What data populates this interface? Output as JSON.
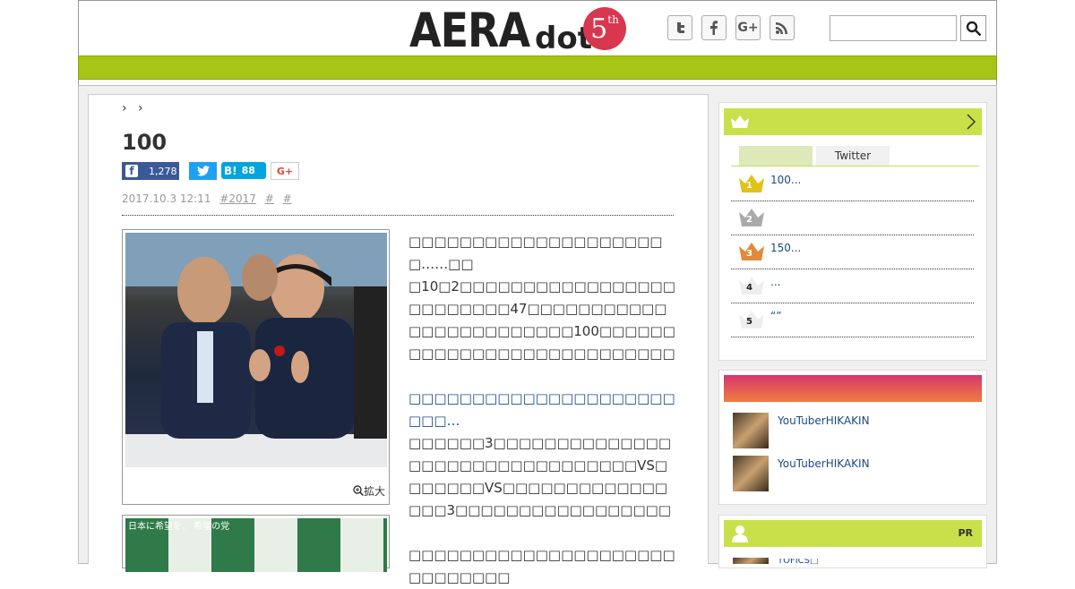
{
  "header": {
    "logo_main": "AERA",
    "logo_sub": "dot",
    "anniversary_number": "5",
    "anniversary_suffix": "th",
    "social": [
      {
        "icon": "twitter-icon",
        "glyph": "t"
      },
      {
        "icon": "facebook-icon",
        "glyph": "f"
      },
      {
        "icon": "google-plus-icon",
        "glyph": "G+"
      },
      {
        "icon": "rss-icon",
        "glyph": ")"
      }
    ],
    "search": {
      "value": "",
      "placeholder": ""
    }
  },
  "colors": {
    "brand_green": "#a6c514",
    "link_blue": "#1a4a8a",
    "rank_gold": "#e0c21a",
    "rank_silver": "#aaaaaa",
    "rank_bronze": "#e08a3a"
  },
  "article": {
    "breadcrumb": "› ›",
    "title": "100",
    "share": {
      "facebook_count": "1,278",
      "hatena_label": "B!",
      "hatena_count": "88",
      "google_label": "G+"
    },
    "meta": {
      "date": "2017.10.3 12:11",
      "tags": [
        "#2017",
        "#",
        "#"
      ]
    },
    "photo_zoom_label": "拡大",
    "photo2_caption": "日本に希望を。 希望の党",
    "paragraphs": [
      "□□□□□□□□□□□□□□□□□□□□□……□□",
      "□10□2□□□□□□□□□□□□□□□□□□□□□□□□□47□□□□□□□□□□□□□□□□□□□□□□□□100□□□□□□□□□□□□□□□□□□□□□□□□□□□□□□□□",
      "□□□□□□□□□□□□□□□□□□□□□□□□…",
      "□□□□□□3□□□□□□□□□□□□□□□□□□□□□□□□□□□□□□□□VS□□□□□□□VS□□□□□□□□□□□□□□□□3□□□□□□□□□□□□□□□□□□□□□□□□□□□□□□□□□□□□□□□□□□",
      "□□□□□□□□□□□□□□□□□□□□□□□□□□□□□"
    ]
  },
  "ranking": {
    "tabs": [
      "",
      "Twitter"
    ],
    "items": [
      {
        "rank": "1",
        "text": "100..."
      },
      {
        "rank": "2",
        "text": ""
      },
      {
        "rank": "3",
        "text": "150..."
      },
      {
        "rank": "4",
        "text": "..."
      },
      {
        "rank": "5",
        "text": "“”"
      }
    ]
  },
  "feature": {
    "items": [
      {
        "text": "YouTuberHIKAKIN"
      },
      {
        "text": "YouTuberHIKAKIN"
      }
    ]
  },
  "pr": {
    "label": "PR",
    "first_item": "TOFICS□"
  }
}
